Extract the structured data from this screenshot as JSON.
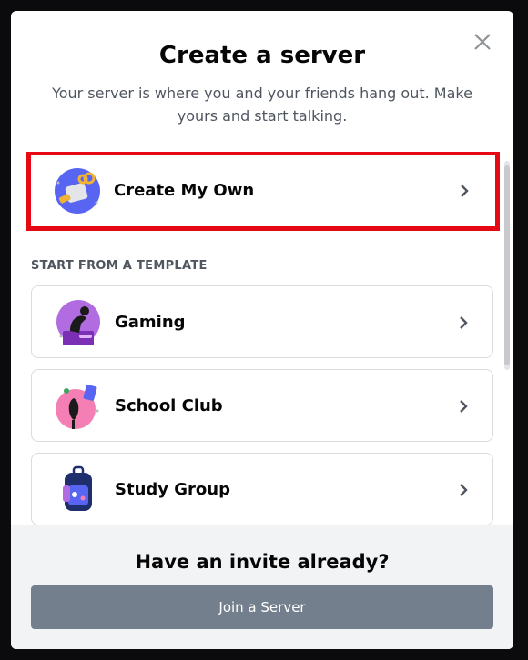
{
  "modal": {
    "title": "Create a server",
    "subtitle": "Your server is where you and your friends hang out. Make yours and start talking.",
    "close_icon": "close-icon"
  },
  "options": {
    "create_own": {
      "label": "Create My Own",
      "icon": "create-server-icon"
    },
    "section_label": "START FROM A TEMPLATE",
    "templates": [
      {
        "label": "Gaming",
        "icon": "gaming-icon"
      },
      {
        "label": "School Club",
        "icon": "school-club-icon"
      },
      {
        "label": "Study Group",
        "icon": "study-group-icon"
      }
    ]
  },
  "footer": {
    "title": "Have an invite already?",
    "join_label": "Join a Server"
  },
  "colors": {
    "highlight": "#e50914",
    "join_button": "#747f8d",
    "footer_bg": "#f2f3f5"
  }
}
